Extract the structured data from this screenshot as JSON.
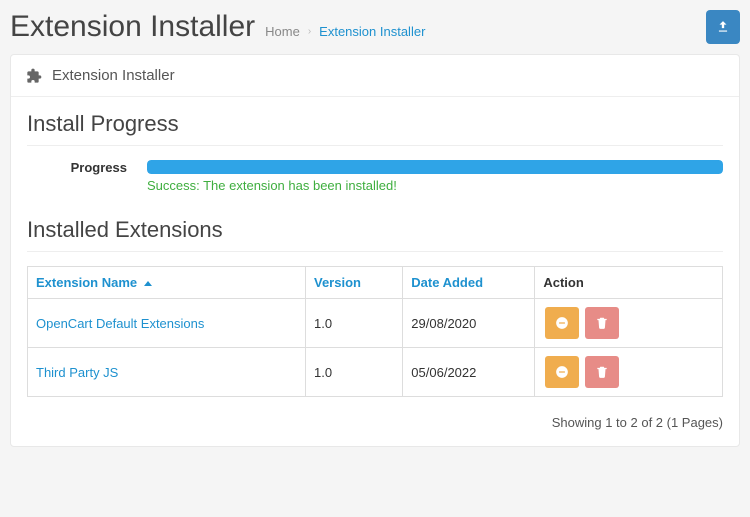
{
  "header": {
    "title": "Extension Installer",
    "breadcrumb": {
      "home": "Home",
      "current": "Extension Installer"
    }
  },
  "panel": {
    "heading": "Extension Installer"
  },
  "install": {
    "legend": "Install Progress",
    "progress_label": "Progress",
    "success_message": "Success: The extension has been installed!"
  },
  "table": {
    "legend": "Installed Extensions",
    "columns": {
      "name": "Extension Name",
      "version": "Version",
      "date_added": "Date Added",
      "action": "Action"
    },
    "rows": [
      {
        "name": "OpenCart Default Extensions",
        "version": "1.0",
        "date_added": "29/08/2020"
      },
      {
        "name": "Third Party JS",
        "version": "1.0",
        "date_added": "05/06/2022"
      }
    ],
    "pagination": "Showing 1 to 2 of 2 (1 Pages)"
  }
}
